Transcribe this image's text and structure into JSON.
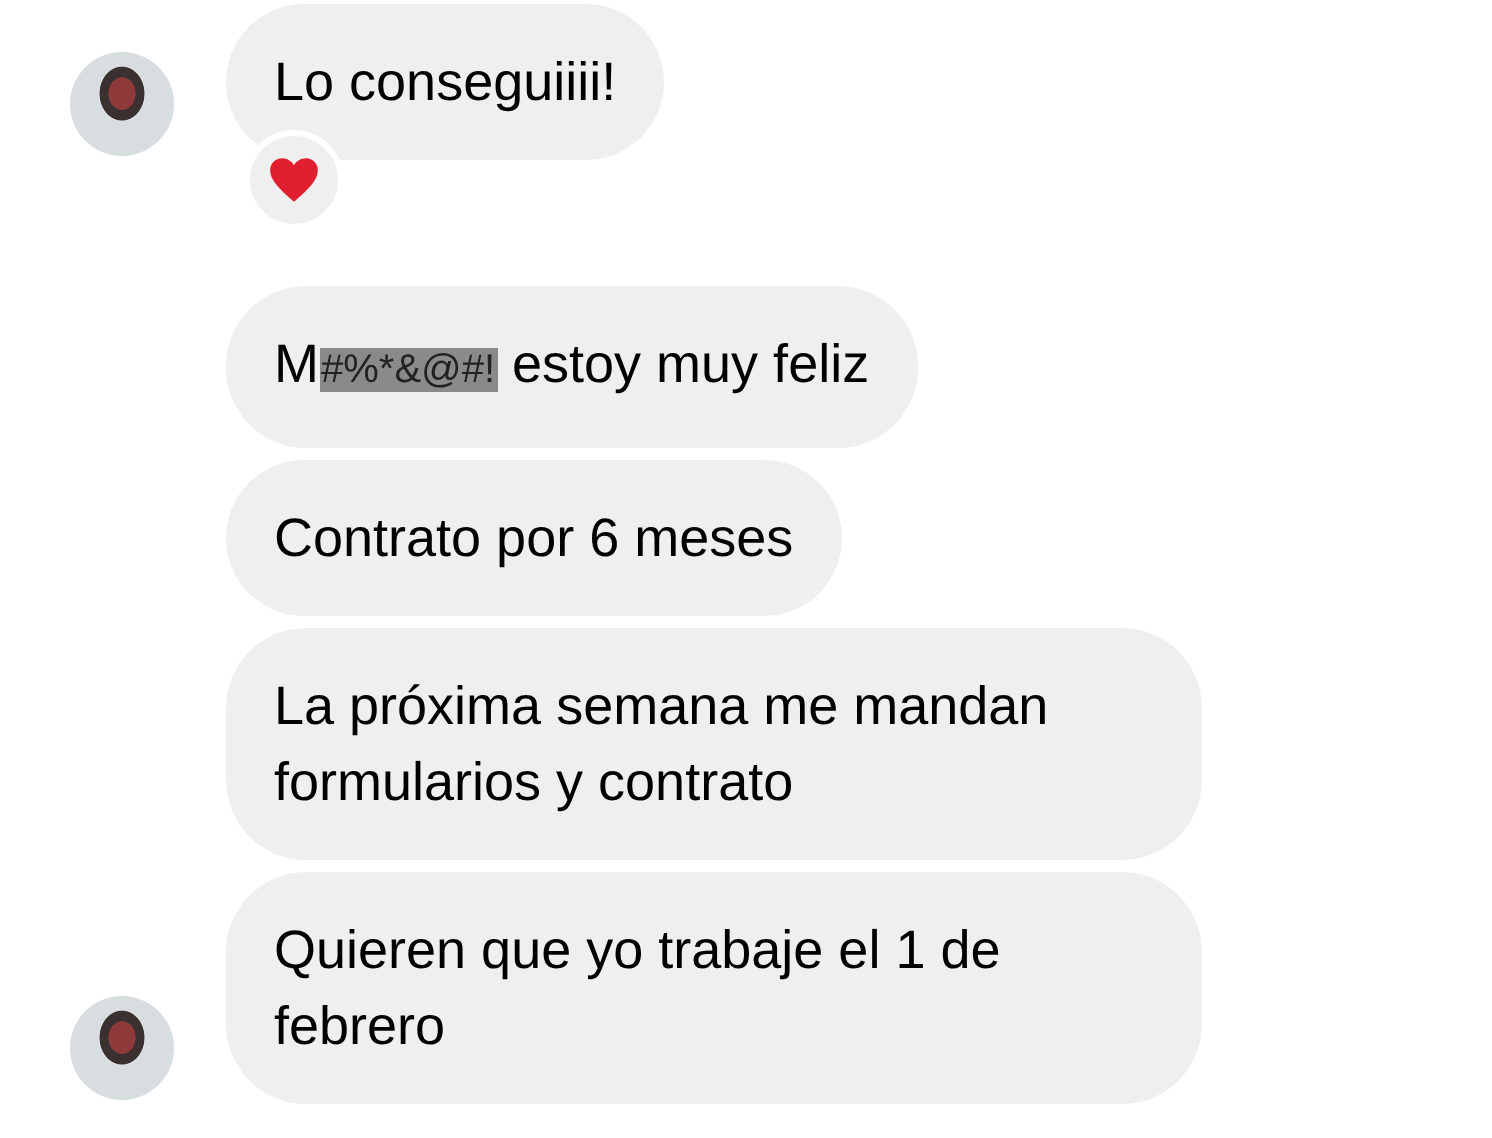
{
  "messages": [
    {
      "avatar": true,
      "reacted": true,
      "segments": [
        {
          "text": "Lo conseguiiii!",
          "censored": false
        }
      ]
    },
    {
      "avatar": false,
      "reacted": false,
      "segments": [
        {
          "text": "M",
          "censored": false
        },
        {
          "text": "#%*&@#!",
          "censored": true
        },
        {
          "text": " estoy muy feliz",
          "censored": false
        }
      ]
    },
    {
      "avatar": false,
      "reacted": false,
      "segments": [
        {
          "text": "Contrato por 6 meses",
          "censored": false
        }
      ]
    },
    {
      "avatar": false,
      "reacted": false,
      "segments": [
        {
          "text": "La próxima semana me mandan formularios y contrato",
          "censored": false
        }
      ]
    },
    {
      "avatar": true,
      "reacted": false,
      "segments": [
        {
          "text": "Quieren que yo trabaje el 1 de febrero",
          "censored": false
        }
      ]
    }
  ]
}
